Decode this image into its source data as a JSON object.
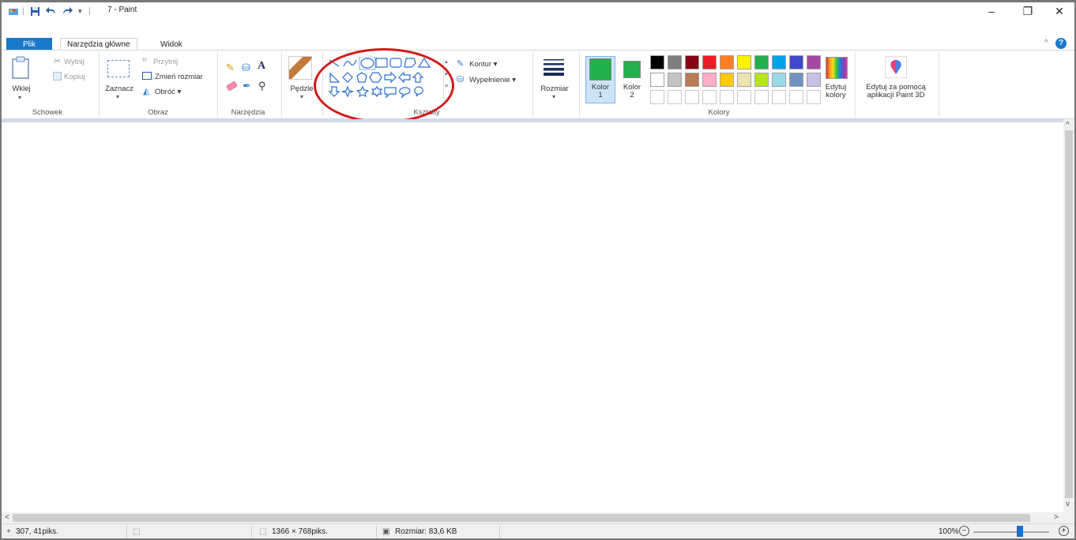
{
  "window": {
    "title": "7 - Paint",
    "minimize": "–",
    "restore": "❐",
    "close": "✕"
  },
  "tabs": {
    "file": "Plik",
    "home": "Narzędzia główne",
    "view": "Widok"
  },
  "clipboard": {
    "paste": "Wklej",
    "cut": "Wytnij",
    "copy": "Kopiuj",
    "label": "Schowek"
  },
  "image": {
    "select": "Zaznacz",
    "crop": "Przytnij",
    "resize": "Zmień rozmiar",
    "rotate": "Obróć ▾",
    "label": "Obraz"
  },
  "tools": {
    "label": "Narzędzia",
    "text_tool": "A"
  },
  "brushes": {
    "label": "Pędzle"
  },
  "shapes": {
    "label": "Kształty",
    "outline": "Kontur ▾",
    "fill": "Wypełnienie ▾"
  },
  "size": {
    "label": "Rozmiar"
  },
  "colors": {
    "color1": "Kolor 1",
    "color1_line1": "Kolor",
    "color1_line2": "1",
    "color2_line1": "Kolor",
    "color2_line2": "2",
    "edit_line1": "Edytuj",
    "edit_line2": "kolory",
    "label": "Kolory",
    "active": "#22b14c",
    "palette_row1": [
      "#000000",
      "#7f7f7f",
      "#880015",
      "#ed1c24",
      "#ff7f27",
      "#fff200",
      "#22b14c",
      "#00a2e8",
      "#3f48cc",
      "#a349a4"
    ],
    "palette_row2": [
      "#ffffff",
      "#c3c3c3",
      "#b97a57",
      "#ffaec9",
      "#ffc90e",
      "#efe4b0",
      "#b5e61d",
      "#99d9ea",
      "#7092be",
      "#c8bfe7"
    ]
  },
  "paint3d": {
    "line1": "Edytuj za pomocą",
    "line2": "aplikacji Paint 3D"
  },
  "status": {
    "cursor": "307, 41piks.",
    "dimensions": "1366 × 768piks.",
    "filesize": "Rozmiar: 83,6 KB",
    "zoom": "100%",
    "zoom_level_percent": 100
  }
}
